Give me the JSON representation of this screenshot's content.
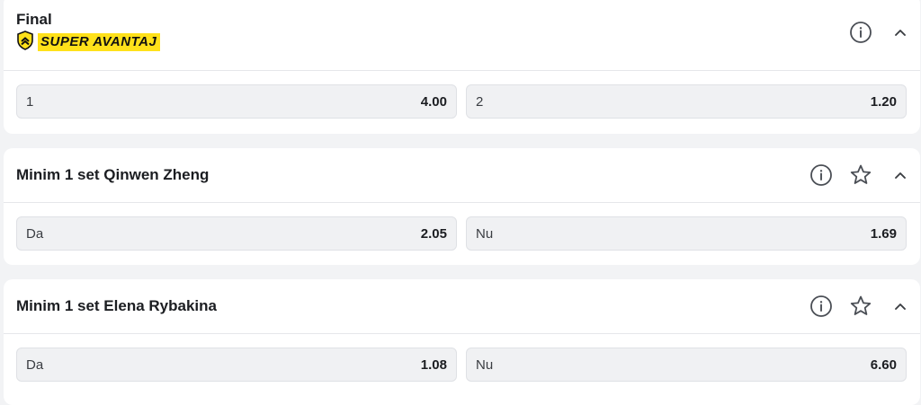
{
  "markets": [
    {
      "title": "Final",
      "promo_label": "SUPER AVANTAJ",
      "icons": [
        "info-icon",
        "chevron-up-icon"
      ],
      "outcomes": [
        {
          "label": "1",
          "odd": "4.00"
        },
        {
          "label": "2",
          "odd": "1.20"
        }
      ]
    },
    {
      "title": "Minim 1 set Qinwen Zheng",
      "icons": [
        "info-icon",
        "star-icon",
        "chevron-up-icon"
      ],
      "outcomes": [
        {
          "label": "Da",
          "odd": "2.05"
        },
        {
          "label": "Nu",
          "odd": "1.69"
        }
      ]
    },
    {
      "title": "Minim 1 set Elena Rybakina",
      "icons": [
        "info-icon",
        "star-icon",
        "chevron-up-icon"
      ],
      "outcomes": [
        {
          "label": "Da",
          "odd": "1.08"
        },
        {
          "label": "Nu",
          "odd": "6.60"
        }
      ]
    }
  ],
  "colors": {
    "background": "#f2f3f5",
    "card": "#ffffff",
    "odd_button": "#f0f1f3",
    "promo_yellow": "#ffe11a",
    "icon_stroke": "#4a4e55"
  }
}
